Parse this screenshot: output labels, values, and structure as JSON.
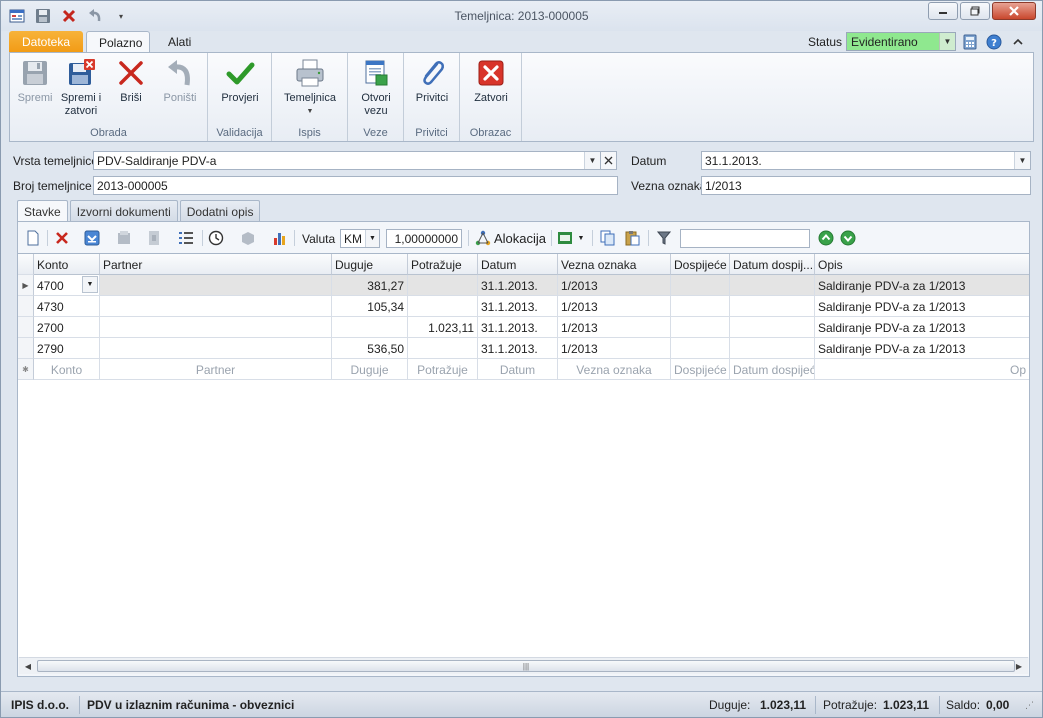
{
  "window": {
    "title": "Temeljnica: 2013-000005"
  },
  "ribbon_tabs": {
    "file": "Datoteka",
    "home": "Polazno",
    "tools": "Alati"
  },
  "status": {
    "label": "Status",
    "value": "Evidentirano",
    "color": "#8fe88f"
  },
  "ribbon": {
    "groups": {
      "obrada": "Obrada",
      "validacija": "Validacija",
      "ispis": "Ispis",
      "veze": "Veze",
      "privitci": "Privitci",
      "obrazac": "Obrazac"
    },
    "buttons": {
      "spremi": "Spremi",
      "spremi_zatvori_1": "Spremi i",
      "spremi_zatvori_2": "zatvori",
      "brisi": "Briši",
      "ponisti": "Poništi",
      "provjeri": "Provjeri",
      "temeljnica": "Temeljnica",
      "otvori_1": "Otvori",
      "otvori_2": "vezu",
      "privitci": "Privitci",
      "zatvori": "Zatvori"
    }
  },
  "form": {
    "vrsta_label": "Vrsta temeljnice",
    "vrsta_value": "PDV-Saldiranje PDV-a",
    "broj_label": "Broj temeljnice",
    "broj_value": "2013-000005",
    "datum_label": "Datum",
    "datum_value": "31.1.2013.",
    "vezna_label": "Vezna oznaka",
    "vezna_value": "1/2013"
  },
  "page_tabs": {
    "stavke": "Stavke",
    "izvorni": "Izvorni dokumenti",
    "dodatni": "Dodatni opis"
  },
  "grid_toolbar": {
    "valuta_label": "Valuta",
    "valuta_value": "KM",
    "rate": "1,00000000",
    "alokacija": "Alokacija"
  },
  "grid": {
    "headers": {
      "konto": "Konto",
      "partner": "Partner",
      "duguje": "Duguje",
      "potrazuje": "Potražuje",
      "datum": "Datum",
      "vezna": "Vezna oznaka",
      "dospijece": "Dospijeće",
      "datum_dosp": "Datum dospij...",
      "opis": "Opis"
    },
    "rows": [
      {
        "konto": "4700",
        "partner": "",
        "duguje": "381,27",
        "potrazuje": "",
        "datum": "31.1.2013.",
        "vezna": "1/2013",
        "dospijece": "",
        "datum_dosp": "",
        "opis": "Saldiranje PDV-a za 1/2013"
      },
      {
        "konto": "4730",
        "partner": "",
        "duguje": "105,34",
        "potrazuje": "",
        "datum": "31.1.2013.",
        "vezna": "1/2013",
        "dospijece": "",
        "datum_dosp": "",
        "opis": "Saldiranje PDV-a za 1/2013"
      },
      {
        "konto": "2700",
        "partner": "",
        "duguje": "",
        "potrazuje": "1.023,11",
        "datum": "31.1.2013.",
        "vezna": "1/2013",
        "dospijece": "",
        "datum_dosp": "",
        "opis": "Saldiranje PDV-a za 1/2013"
      },
      {
        "konto": "2790",
        "partner": "",
        "duguje": "536,50",
        "potrazuje": "",
        "datum": "31.1.2013.",
        "vezna": "1/2013",
        "dospijece": "",
        "datum_dosp": "",
        "opis": "Saldiranje PDV-a za 1/2013"
      }
    ],
    "new_row": {
      "konto": "Konto",
      "partner": "Partner",
      "duguje": "Duguje",
      "potrazuje": "Potražuje",
      "datum": "Datum",
      "vezna": "Vezna oznaka",
      "dospijece": "Dospijeće",
      "datum_dosp": "Datum dospijeća",
      "opis": "Op"
    }
  },
  "statusbar": {
    "company": "IPIS d.o.o.",
    "doc_type": "PDV u izlaznim računima - obveznici",
    "duguje_label": "Duguje:",
    "duguje_value": "1.023,11",
    "potrazuje_label": "Potražuje:",
    "potrazuje_value": "1.023,11",
    "saldo_label": "Saldo:",
    "saldo_value": "0,00"
  }
}
